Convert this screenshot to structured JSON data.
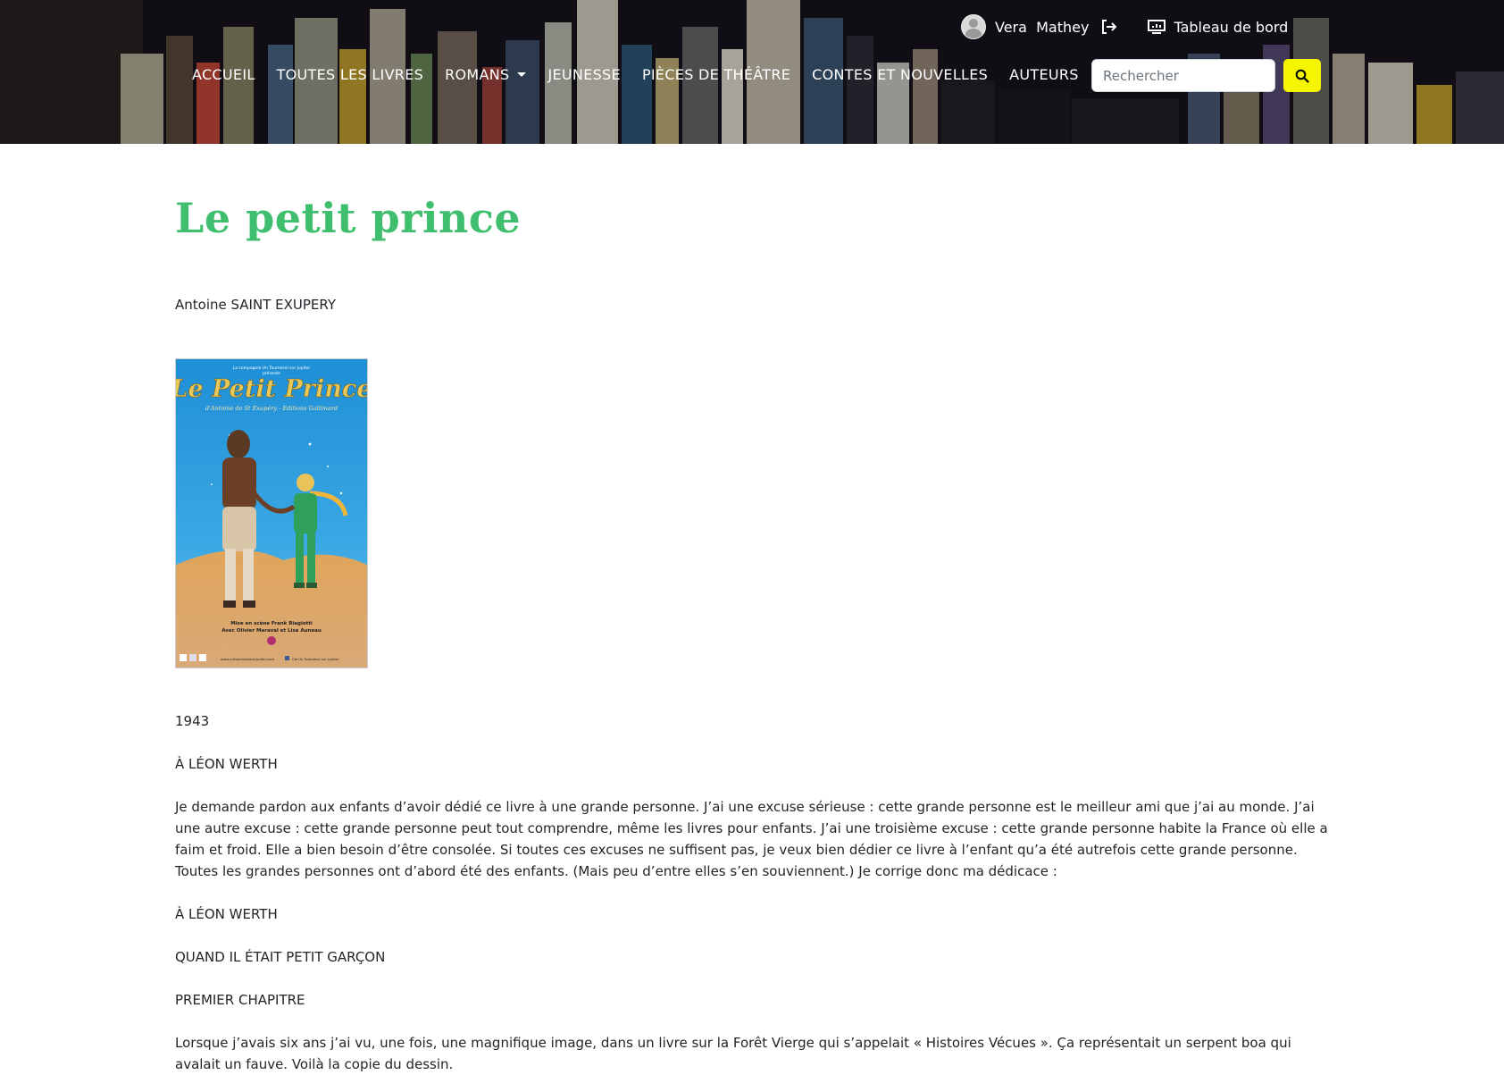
{
  "header": {
    "user": {
      "name": "Vera  Mathey"
    },
    "dashboard_label": "Tableau de bord",
    "nav": [
      {
        "label": "Accueil"
      },
      {
        "label": "Toutes les livres"
      },
      {
        "label": "Romans",
        "dropdown": true
      },
      {
        "label": "Jeunesse"
      },
      {
        "label": "Pièces de théâtre"
      },
      {
        "label": "Contes et nouvelles"
      },
      {
        "label": "Auteurs"
      }
    ],
    "search": {
      "placeholder": "Rechercher",
      "value": ""
    }
  },
  "book": {
    "title": "Le petit prince",
    "author": "Antoine SAINT EXUPERY",
    "cover": {
      "top_line": "La compagnie Un Tournesol sur Jupiter",
      "presents": "présente",
      "title": "Le Petit Prince",
      "subtitle": "d'Antoine de St Exupéry - Editions Gallimard",
      "credits_1": "Mise en scène Frank Biagiotti",
      "credits_2": "Avec Olivier Maraval et Lisa Auneau",
      "website": "www.untournesolsurjupiter.com",
      "facebook": "Cie Un Tournesol sur Jupiter"
    },
    "year": "1943",
    "paragraphs": [
      "À LÉON WERTH",
      "Je demande pardon aux enfants d’avoir dédié ce livre à une grande personne. J’ai une excuse sérieuse : cette grande personne est le meilleur ami que j’ai au monde. J’ai une autre excuse : cette grande personne peut tout comprendre, même les livres pour enfants. J’ai une troisième excuse : cette grande personne habite la France où elle a faim et froid. Elle a bien besoin d’être consolée. Si toutes ces excuses ne suffisent pas, je veux bien dédier ce livre à l’enfant qu’a été autrefois cette grande personne. Toutes les grandes personnes ont d’abord été des enfants. (Mais peu d’entre elles s’en souviennent.) Je corrige donc ma dédicace :",
      "À LÉON WERTH",
      "QUAND IL ÉTAIT PETIT GARÇON",
      "PREMIER CHAPITRE",
      "Lorsque j’avais six ans j’ai vu, une fois, une magnifique image, dans un livre sur la Forêt Vierge qui s’appelait « Histoires Vécues ». Ça représentait un serpent boa qui avalait un fauve. Voilà la copie du dessin."
    ]
  },
  "colors": {
    "title": "#3fbf6e",
    "search_button": "#f5f500",
    "header_bg": "#1a1620"
  },
  "icons": [
    "user-avatar-icon",
    "logout-icon",
    "dashboard-icon",
    "search-icon",
    "chevron-down-icon"
  ]
}
